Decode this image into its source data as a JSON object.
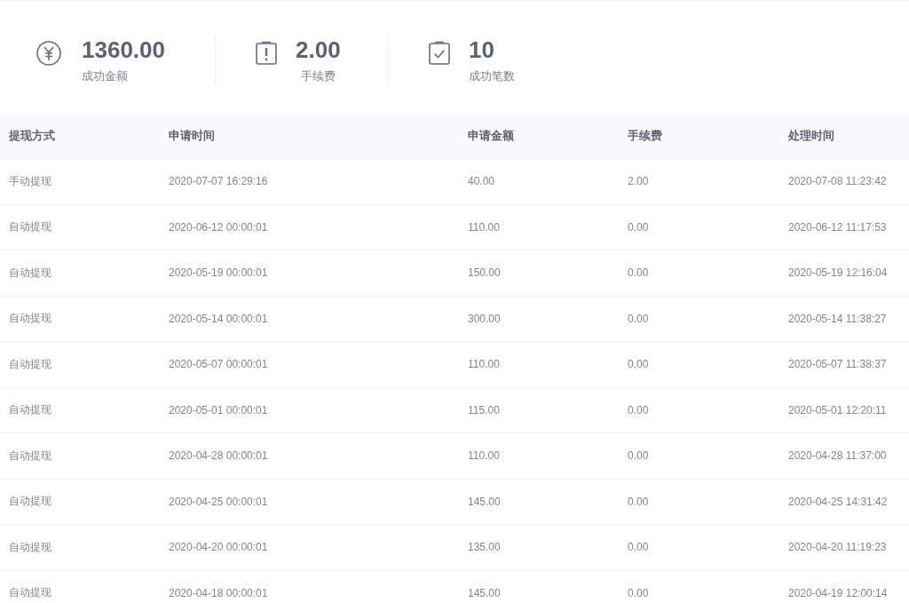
{
  "stats": [
    {
      "kind": "yuan",
      "value": "1360.00",
      "label": "成功金额"
    },
    {
      "kind": "alert",
      "value": "2.00",
      "label": "手续费"
    },
    {
      "kind": "check",
      "value": "10",
      "label": "成功笔数"
    }
  ],
  "table": {
    "columns": [
      "提现方式",
      "申请时间",
      "申请金额",
      "手续费",
      "处理时间"
    ],
    "rows": [
      [
        "手动提现",
        "2020-07-07 16:29:16",
        "40.00",
        "2.00",
        "2020-07-08 11:23:42"
      ],
      [
        "自动提现",
        "2020-06-12 00:00:01",
        "110.00",
        "0.00",
        "2020-06-12 11:17:53"
      ],
      [
        "自动提现",
        "2020-05-19 00:00:01",
        "150.00",
        "0.00",
        "2020-05-19 12:16:04"
      ],
      [
        "自动提现",
        "2020-05-14 00:00:01",
        "300.00",
        "0.00",
        "2020-05-14 11:38:27"
      ],
      [
        "自动提现",
        "2020-05-07 00:00:01",
        "110.00",
        "0.00",
        "2020-05-07 11:38:37"
      ],
      [
        "自动提现",
        "2020-05-01 00:00:01",
        "115.00",
        "0.00",
        "2020-05-01 12:20:11"
      ],
      [
        "自动提现",
        "2020-04-28 00:00:01",
        "110.00",
        "0.00",
        "2020-04-28 11:37:00"
      ],
      [
        "自动提现",
        "2020-04-25 00:00:01",
        "145.00",
        "0.00",
        "2020-04-25 14:31:42"
      ],
      [
        "自动提现",
        "2020-04-20 00:00:01",
        "135.00",
        "0.00",
        "2020-04-20 11:19:23"
      ],
      [
        "自动提现",
        "2020-04-18 00:00:01",
        "145.00",
        "0.00",
        "2020-04-19 12:00:14"
      ]
    ]
  }
}
